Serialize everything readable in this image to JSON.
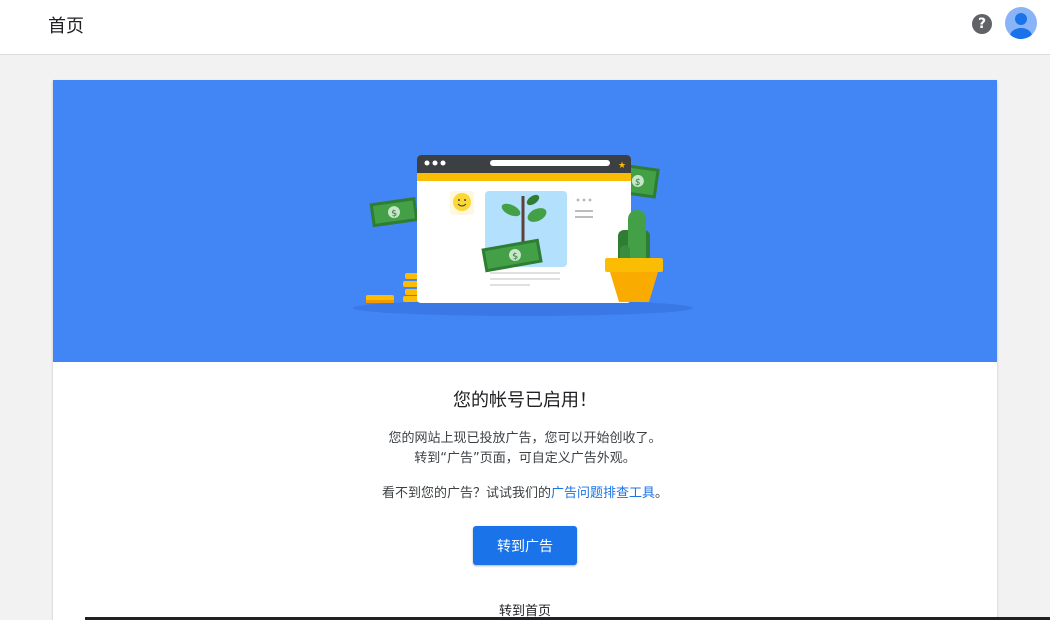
{
  "header": {
    "title": "首页",
    "help_icon": "help-icon",
    "help_glyph": "?",
    "avatar_icon": "account-avatar-icon"
  },
  "hero": {
    "illustration": "browser-window-with-plant-money-cactus-coins",
    "background_color": "#4285f4"
  },
  "main": {
    "headline": "您的帐号已启用！",
    "line1": "您的网站上现已投放广告，您可以开始创收了。",
    "line2": "转到“广告”页面，可自定义广告外观。",
    "line3_prefix": "看不到您的广告？试试我们的",
    "line3_link": "广告问题排查工具",
    "line3_suffix": "。",
    "primary_button": "转到广告",
    "secondary_link": "转到首页"
  },
  "colors": {
    "accent": "#1a73e8",
    "money_green": "#43a047",
    "coin_gold": "#fbbc04"
  }
}
